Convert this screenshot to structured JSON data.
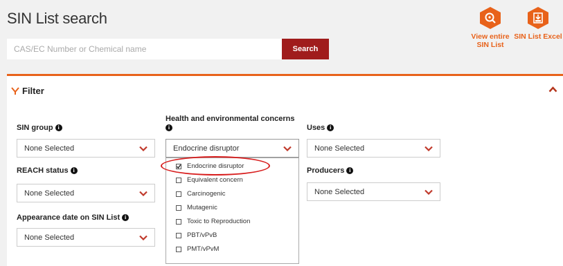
{
  "header": {
    "title": "SIN List search"
  },
  "search": {
    "placeholder": "CAS/EC Number or Chemical name",
    "button_label": "Search"
  },
  "actions": [
    {
      "label_line1": "View entire",
      "label_line2": "SIN List",
      "icon": "magnifier-icon"
    },
    {
      "label_line1": "SIN List Excel",
      "label_line2": "",
      "icon": "excel-download-icon"
    }
  ],
  "colors": {
    "accent": "#e8621a",
    "search_button": "#a01c1c",
    "highlight_ring": "#d81e1e"
  },
  "filter": {
    "title": "Filter",
    "sin_group": {
      "label": "SIN group",
      "value": "None Selected"
    },
    "concerns": {
      "label_line1": "Health and environmental concerns",
      "value": "Endocrine disruptor"
    },
    "uses": {
      "label": "Uses",
      "value": "None Selected"
    },
    "reach_status": {
      "label": "REACH status",
      "value": "None Selected"
    },
    "producers": {
      "label": "Producers",
      "value": "None Selected"
    },
    "appearance_date": {
      "label": "Appearance date on SIN List",
      "value": "None Selected"
    },
    "concern_options": [
      {
        "label": "Endocrine disruptor",
        "checked": true
      },
      {
        "label": "Equivalent concern",
        "checked": false
      },
      {
        "label": "Carcinogenic",
        "checked": false
      },
      {
        "label": "Mutagenic",
        "checked": false
      },
      {
        "label": "Toxic to Reproduction",
        "checked": false
      },
      {
        "label": "PBT/vPvB",
        "checked": false
      },
      {
        "label": "PMT/vPvM",
        "checked": false
      }
    ]
  }
}
